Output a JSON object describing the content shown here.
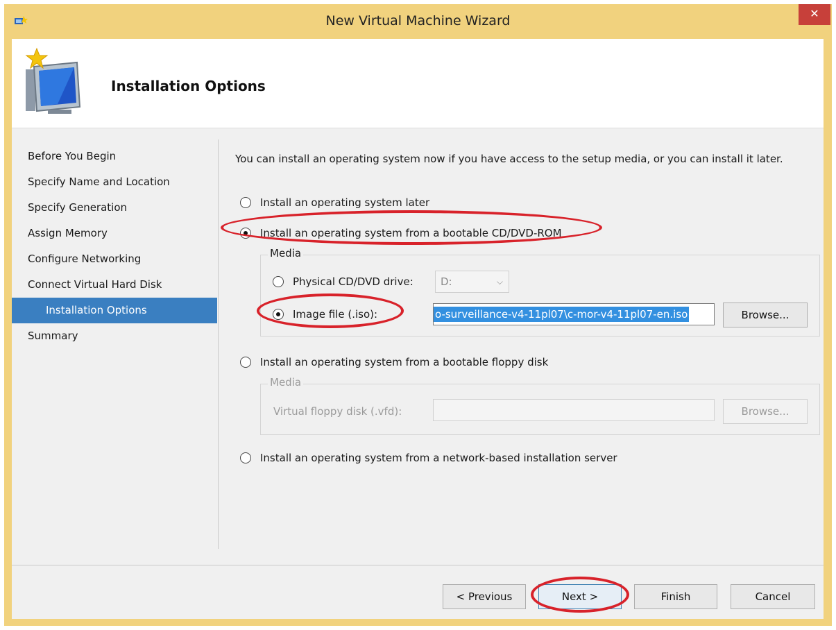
{
  "window": {
    "title": "New Virtual Machine Wizard",
    "close_glyph": "✕",
    "accent": "#f1d27e",
    "close_color": "#c7403a"
  },
  "header": {
    "title": "Installation Options",
    "icon": "new-vm-monitor-icon"
  },
  "sidebar": {
    "items": [
      {
        "label": "Before You Begin",
        "selected": false
      },
      {
        "label": "Specify Name and Location",
        "selected": false
      },
      {
        "label": "Specify Generation",
        "selected": false
      },
      {
        "label": "Assign Memory",
        "selected": false
      },
      {
        "label": "Configure Networking",
        "selected": false
      },
      {
        "label": "Connect Virtual Hard Disk",
        "selected": false
      },
      {
        "label": "Installation Options",
        "selected": true
      },
      {
        "label": "Summary",
        "selected": false
      }
    ],
    "selected_color": "#3a7fc1"
  },
  "main": {
    "intro": "You can install an operating system now if you have access to the setup media, or you can install it later.",
    "options": {
      "later": {
        "label": "Install an operating system later",
        "checked": false
      },
      "cd": {
        "label": "Install an operating system from a bootable CD/DVD-ROM",
        "checked": true
      },
      "floppy": {
        "label": "Install an operating system from a bootable floppy disk",
        "checked": false
      },
      "network": {
        "label": "Install an operating system from a network-based installation server",
        "checked": false
      }
    },
    "cd_media": {
      "legend": "Media",
      "physical_label": "Physical CD/DVD drive:",
      "physical_checked": false,
      "drive_value": "D:",
      "image_label": "Image file (.iso):",
      "image_checked": true,
      "image_value": "o-surveillance-v4-11pl07\\c-mor-v4-11pl07-en.iso",
      "browse": "Browse..."
    },
    "floppy_media": {
      "legend": "Media",
      "vfd_label": "Virtual floppy disk (.vfd):",
      "vfd_value": "",
      "browse": "Browse..."
    }
  },
  "footer": {
    "previous": "< Previous",
    "next": "Next >",
    "finish": "Finish",
    "cancel": "Cancel"
  },
  "annotations": {
    "highlight_color": "#d8222a"
  }
}
